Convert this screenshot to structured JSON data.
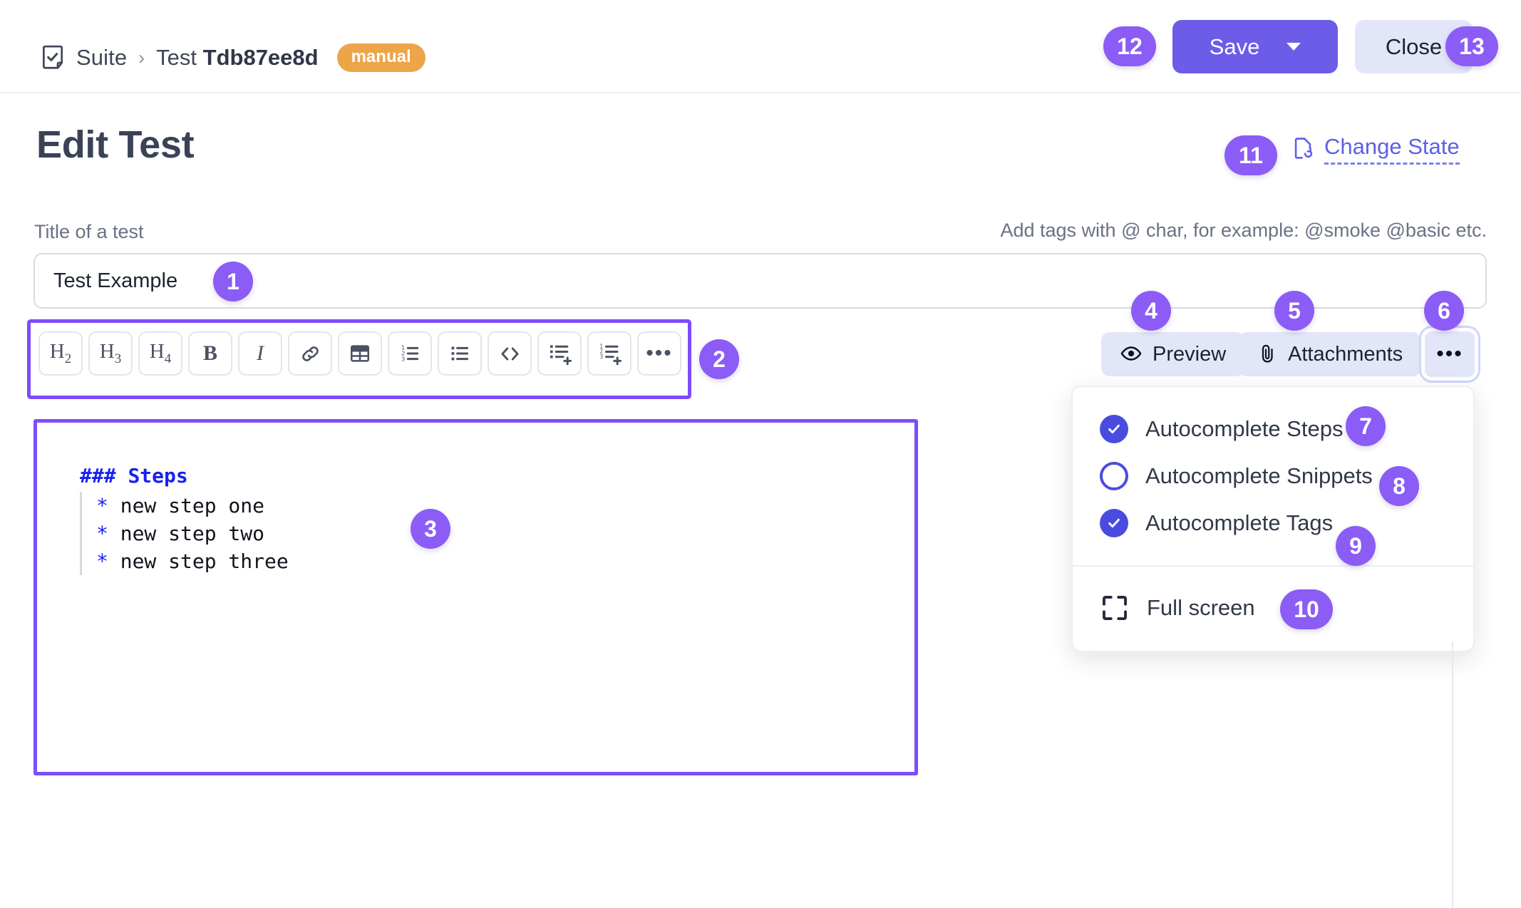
{
  "header": {
    "breadcrumb": {
      "suite": "Suite",
      "separator": "›",
      "test_prefix": "Test ",
      "test_id": "Tdb87ee8d",
      "type_badge": "manual"
    },
    "save_label": "Save",
    "close_label": "Close"
  },
  "page": {
    "title": "Edit Test",
    "change_state_label": "Change State"
  },
  "form": {
    "title_field_label": "Title of a test",
    "tags_hint": "Add tags with @ char, for example: @smoke @basic etc.",
    "title_value": "Test Example",
    "title_placeholder": "Title of a test"
  },
  "toolbar": {
    "buttons": [
      {
        "name": "heading-2",
        "text": "H",
        "sub": "2"
      },
      {
        "name": "heading-3",
        "text": "H",
        "sub": "3"
      },
      {
        "name": "heading-4",
        "text": "H",
        "sub": "4"
      },
      {
        "name": "bold",
        "text": "B"
      },
      {
        "name": "italic",
        "text": "I"
      },
      {
        "name": "link",
        "icon": "link-icon"
      },
      {
        "name": "table",
        "icon": "table-icon"
      },
      {
        "name": "ordered-list",
        "icon": "ordered-list-icon"
      },
      {
        "name": "bullet-list",
        "icon": "bullet-list-icon"
      },
      {
        "name": "code",
        "icon": "code-icon"
      },
      {
        "name": "add-bullet-list",
        "icon": "bullet-list-plus-icon"
      },
      {
        "name": "add-ordered-list",
        "icon": "ordered-list-plus-icon"
      },
      {
        "name": "more",
        "icon": "ellipsis-icon",
        "text": "•••"
      }
    ]
  },
  "editor": {
    "heading_marker": "###",
    "heading_text": "Steps",
    "bullet_marker": "*",
    "steps": [
      "new step one",
      "new step two",
      "new step three"
    ]
  },
  "actions": {
    "preview_label": "Preview",
    "attachments_label": "Attachments",
    "more_label": "•••"
  },
  "dropdown": {
    "items": [
      {
        "label": "Autocomplete Steps",
        "checked": true
      },
      {
        "label": "Autocomplete Snippets",
        "checked": false
      },
      {
        "label": "Autocomplete Tags",
        "checked": true
      }
    ],
    "fullscreen_label": "Full screen"
  },
  "annotations": [
    {
      "id": "1",
      "label": "1"
    },
    {
      "id": "2",
      "label": "2"
    },
    {
      "id": "3",
      "label": "3"
    },
    {
      "id": "4",
      "label": "4"
    },
    {
      "id": "5",
      "label": "5"
    },
    {
      "id": "6",
      "label": "6"
    },
    {
      "id": "7",
      "label": "7"
    },
    {
      "id": "8",
      "label": "8"
    },
    {
      "id": "9",
      "label": "9"
    },
    {
      "id": "10",
      "label": "10"
    },
    {
      "id": "11",
      "label": "11"
    },
    {
      "id": "12",
      "label": "12"
    },
    {
      "id": "13",
      "label": "13"
    }
  ],
  "colors": {
    "accent": "#6c5ce7",
    "annotation": "#8b5cf6",
    "highlight_border": "#7c4dff",
    "manual_badge": "#eda54a",
    "link": "#5b61e8",
    "checkbox_on": "#4a4ce0",
    "markdown_syntax": "#1821f0",
    "soft_button": "#e3e6f8"
  }
}
